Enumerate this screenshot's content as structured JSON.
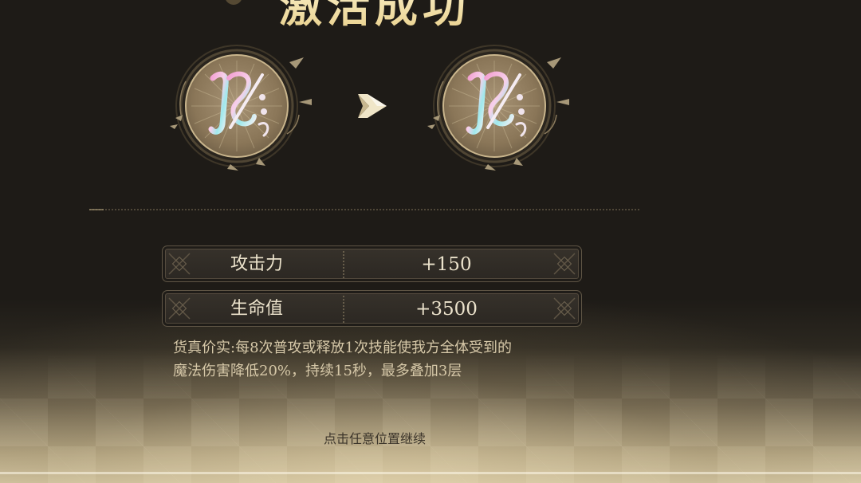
{
  "title": "激活成功",
  "emblems": {
    "before_icon": "ornate-rune-emblem-icon",
    "arrow_icon": "arrow-right-icon",
    "after_icon": "ornate-rune-emblem-icon"
  },
  "stats": [
    {
      "label": "攻击力",
      "value": "+150"
    },
    {
      "label": "生命值",
      "value": "+3500"
    }
  ],
  "description": {
    "line1": "货真价实:每8次普攻或释放1次技能使我方全体受到的",
    "line2": "魔法伤害降低20%，持续15秒，最多叠加3层"
  },
  "continue_hint": "点击任意位置继续",
  "colors": {
    "accent_gold": "#e8cf8a",
    "text_light": "#ece3cc",
    "background_dark": "#1e1b17",
    "emblem_pink": "#e98fc3",
    "emblem_cyan": "#8fe3e8"
  }
}
